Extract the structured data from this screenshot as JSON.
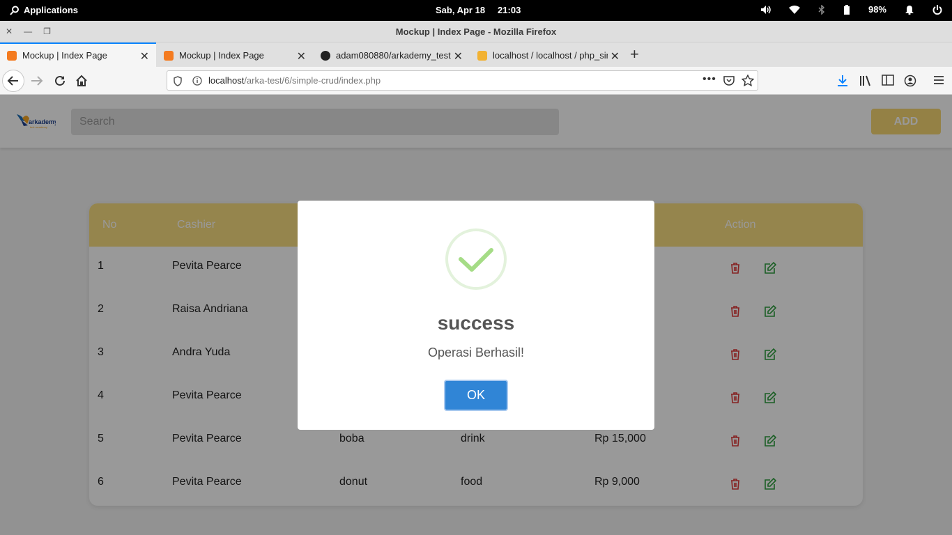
{
  "os": {
    "apps_label": "Applications",
    "date": "Sab, Apr 18",
    "time": "21:03",
    "battery_pct": "98%"
  },
  "window": {
    "title": "Mockup | Index Page - Mozilla Firefox"
  },
  "tabs": [
    {
      "label": "Mockup | Index Page",
      "active": true
    },
    {
      "label": "Mockup | Index Page",
      "active": false
    },
    {
      "label": "adam080880/arkademy_test",
      "active": false
    },
    {
      "label": "localhost / localhost / php_sim",
      "active": false
    }
  ],
  "url": {
    "host": "localhost",
    "path": "/arka-test/6/simple-crud/index.php"
  },
  "app": {
    "logo_text": "arkademy",
    "logo_subtext": "tech academy",
    "search_placeholder": "Search",
    "add_label": "ADD"
  },
  "table": {
    "headers": [
      "No",
      "Cashier",
      "Action"
    ],
    "rows": [
      {
        "no": "1",
        "cashier": "Pevita Pearce",
        "product": "",
        "category": "",
        "price": ""
      },
      {
        "no": "2",
        "cashier": "Raisa Andriana",
        "product": "",
        "category": "",
        "price": ""
      },
      {
        "no": "3",
        "cashier": "Andra Yuda",
        "product": "",
        "category": "",
        "price": ""
      },
      {
        "no": "4",
        "cashier": "Pevita Pearce",
        "product": "",
        "category": "",
        "price": ""
      },
      {
        "no": "5",
        "cashier": "Pevita Pearce",
        "product": "boba",
        "category": "drink",
        "price": "Rp 15,000"
      },
      {
        "no": "6",
        "cashier": "Pevita Pearce",
        "product": "donut",
        "category": "food",
        "price": "Rp 9,000"
      }
    ]
  },
  "modal": {
    "title": "success",
    "message": "Operasi Berhasil!",
    "ok_label": "OK"
  },
  "colors": {
    "accent_yellow": "#f9de80",
    "delete_red": "#e03a3a",
    "edit_green": "#2e9e3e",
    "ok_blue": "#3085d6",
    "success_green": "#a5dc86"
  }
}
